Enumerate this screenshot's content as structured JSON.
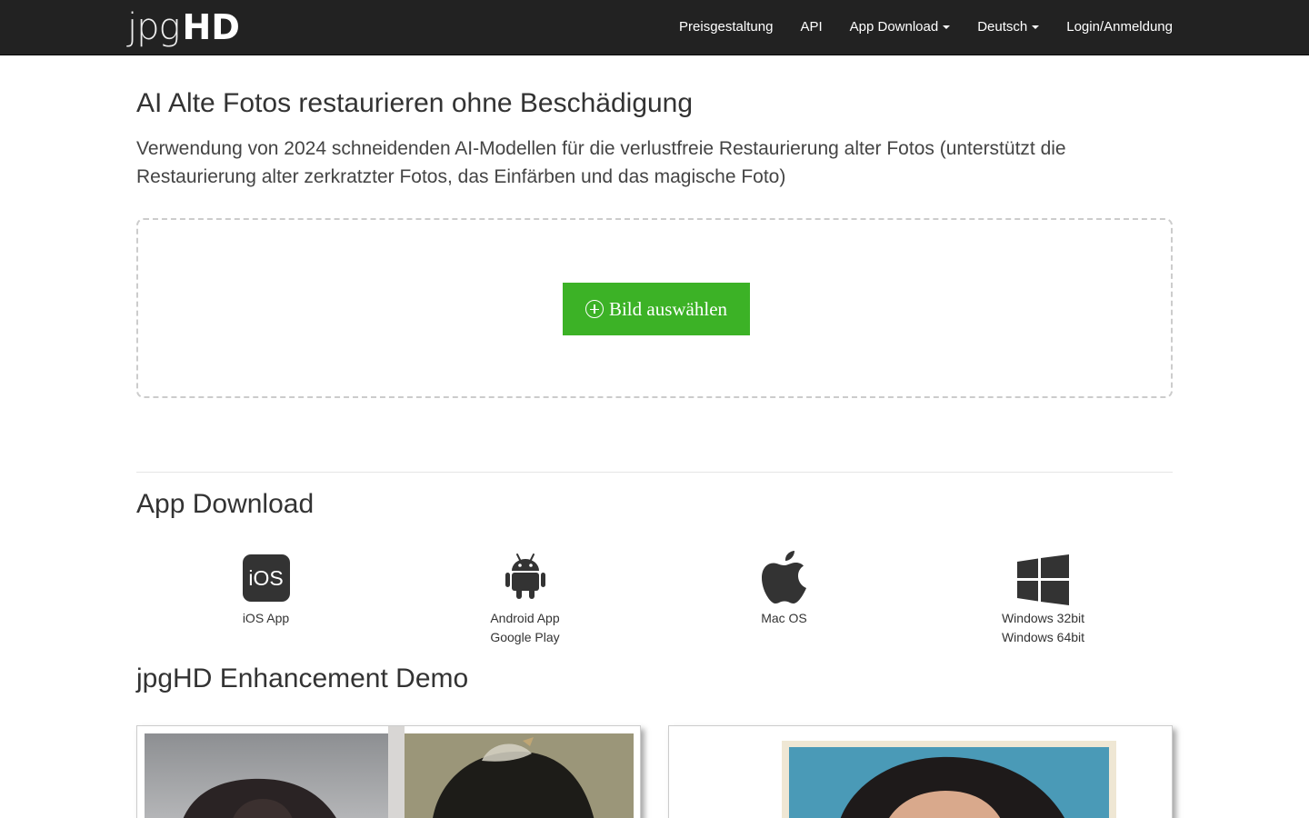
{
  "navbar": {
    "brand_light": "jpg",
    "brand_bold": "HD",
    "items": [
      {
        "label": "Preisgestaltung",
        "dropdown": false
      },
      {
        "label": "API",
        "dropdown": false
      },
      {
        "label": "App Download",
        "dropdown": true
      },
      {
        "label": "Deutsch",
        "dropdown": true
      },
      {
        "label": "Login/Anmeldung",
        "dropdown": false
      }
    ]
  },
  "hero": {
    "title": "AI Alte Fotos restaurieren ohne Beschädigung",
    "subtitle": "Verwendung von 2024 schneidenden AI-Modellen für die verlustfreie Restaurierung alter Fotos (unterstützt die Restaurierung alter zerkratzter Fotos, das Einfärben und das magische Foto)"
  },
  "upload": {
    "button_label": "Bild auswählen",
    "button_color": "#3cb226"
  },
  "app_download": {
    "title": "App Download",
    "apps": [
      {
        "icon": "ios-icon",
        "badge_text": "iOS",
        "lines": [
          "iOS App"
        ]
      },
      {
        "icon": "android-icon",
        "lines": [
          "Android App",
          "Google Play"
        ]
      },
      {
        "icon": "apple-icon",
        "lines": [
          "Mac OS"
        ]
      },
      {
        "icon": "windows-icon",
        "lines": [
          "Windows 32bit",
          "Windows 64bit"
        ]
      }
    ]
  },
  "demo": {
    "title": "jpgHD Enhancement Demo"
  },
  "colors": {
    "navbar_bg": "#222222",
    "accent_green": "#3cb226"
  }
}
